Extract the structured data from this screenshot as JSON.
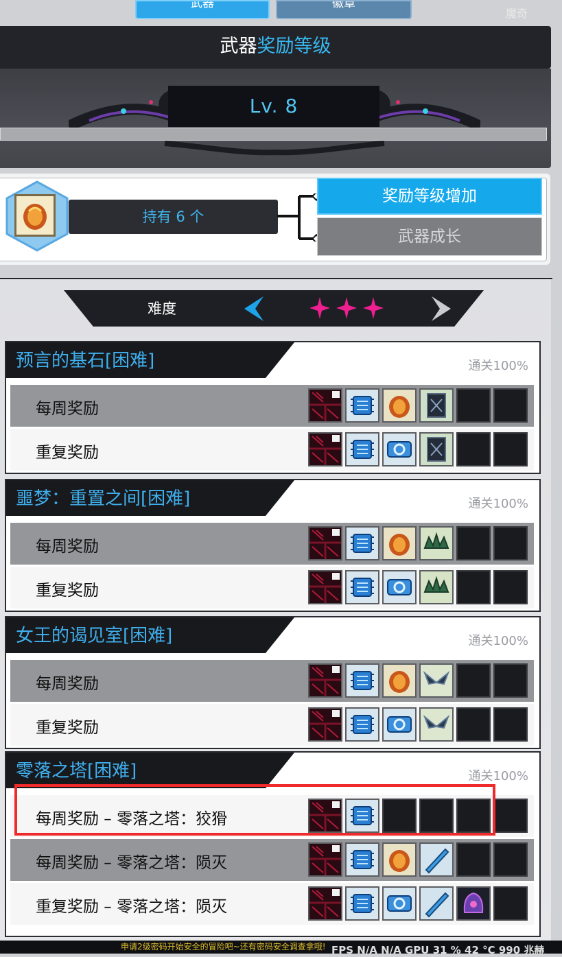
{
  "top": {
    "tab_weapon": "武器",
    "tab_emblem": "徽章",
    "right_label": "魔奇"
  },
  "header": {
    "title_part1": "武器",
    "title_part2": "奖励等级",
    "level": "Lv. 8",
    "level_progress": 0.0
  },
  "hold": {
    "text": "持有 6 个",
    "btn_reward_level": "奖励等级增加",
    "btn_weapon_growth": "武器成长"
  },
  "difficulty": {
    "label": "难度",
    "stars": 3
  },
  "stages": [
    {
      "title": "预言的基石[困难]",
      "clear": "通关100%",
      "rows": [
        {
          "label": "每周奖励",
          "items": [
            "shirt-icon",
            "chip-icon",
            "seed-icon",
            "card-icon",
            "empty",
            "empty"
          ]
        },
        {
          "label": "重复奖励",
          "items": [
            "shirt-icon",
            "chip-icon",
            "ticket-icon",
            "card-icon",
            "empty",
            "empty"
          ]
        }
      ]
    },
    {
      "title": "噩梦：重置之间[困难]",
      "clear": "通关100%",
      "rows": [
        {
          "label": "每周奖励",
          "items": [
            "shirt-icon",
            "chip-icon",
            "seed-icon",
            "crown-icon",
            "empty",
            "empty"
          ]
        },
        {
          "label": "重复奖励",
          "items": [
            "shirt-icon",
            "chip-icon",
            "ticket-icon",
            "crown-icon",
            "empty",
            "empty"
          ]
        }
      ]
    },
    {
      "title": "女王的谒见室[困难]",
      "clear": "通关100%",
      "rows": [
        {
          "label": "每周奖励",
          "items": [
            "shirt-icon",
            "chip-icon",
            "seed-icon",
            "wing-icon",
            "empty",
            "empty"
          ]
        },
        {
          "label": "重复奖励",
          "items": [
            "shirt-icon",
            "chip-icon",
            "ticket-icon",
            "wing-icon",
            "empty",
            "empty"
          ]
        }
      ]
    },
    {
      "title": "零落之塔[困难]",
      "clear": "通关100%",
      "rows": [
        {
          "label": "每周奖励 – 零落之塔：狡猾",
          "items": [
            "shirt-icon",
            "chip-icon",
            "empty",
            "empty",
            "empty",
            "empty"
          ]
        },
        {
          "label": "每周奖励 – 零落之塔：陨灭",
          "items": [
            "shirt-icon",
            "chip-icon",
            "seed-icon",
            "blade-icon",
            "empty",
            "empty"
          ]
        },
        {
          "label": "重复奖励 – 零落之塔：陨灭",
          "items": [
            "shirt-icon",
            "chip-icon",
            "ticket-icon",
            "blade-icon",
            "helm-icon",
            "empty"
          ]
        }
      ]
    }
  ],
  "footer": {
    "notice": "申请2级密码开始安全的冒险吧~还有密码安全调查拿哦!",
    "fps": "FPS N/A N/A GPU 31 % 42 °C 990 兆赫"
  },
  "colors": {
    "accent_blue": "#15a9ec",
    "title_blue": "#3fb0ef",
    "star_pink": "#ee1f8f",
    "highlight_red": "#ee2a2a"
  }
}
